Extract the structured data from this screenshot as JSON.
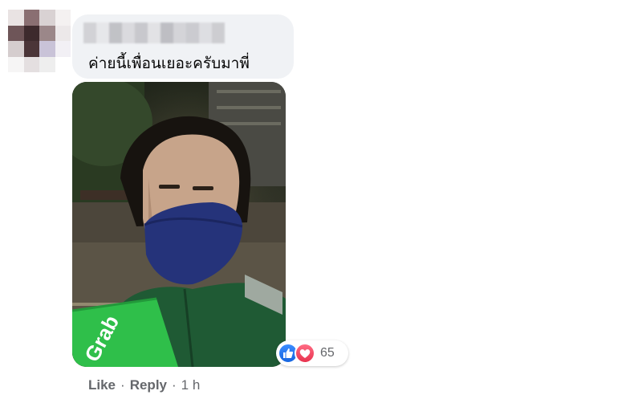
{
  "comment": {
    "text": "ค่ายนี้เพื่อนเยอะครับมาพี่",
    "photo_text": "Grab",
    "reactions": {
      "icons": [
        "like-icon",
        "love-icon"
      ],
      "count": "65"
    },
    "actions": {
      "like": "Like",
      "reply": "Reply",
      "separator": "·",
      "time": "1 h"
    }
  },
  "colors": {
    "bubble": "#f0f2f5",
    "meta_text": "#65676b",
    "like_blue": "#1877f2",
    "love_red": "#f33e58",
    "grab_green": "#2fbf4a"
  }
}
